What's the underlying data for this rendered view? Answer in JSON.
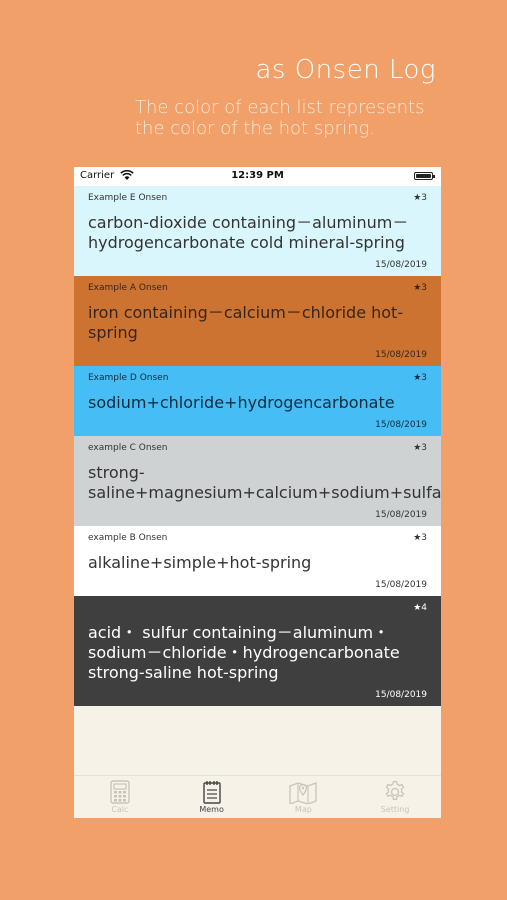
{
  "promo": {
    "headline": "as Onsen Log",
    "subline": "The color of each list represents the color of the hot spring."
  },
  "status_bar": {
    "carrier": "Carrier",
    "time": "12:39 PM"
  },
  "memos": [
    {
      "onsen": "Example E Onsen",
      "rating": "★3",
      "quality": "carbon-dioxide containing－aluminum－hydrogencarbonate cold mineral-spring",
      "date": "15/08/2019",
      "bg": "#d8f6fb",
      "fg": "#333333"
    },
    {
      "onsen": "Example A Onsen",
      "rating": "★3",
      "quality": "iron containing－calcium－chloride hot-spring",
      "date": "15/08/2019",
      "bg": "#cd7332",
      "fg": "#3a2415"
    },
    {
      "onsen": "Example D Onsen",
      "rating": "★3",
      "quality": "sodium+chloride+hydrogencarbonate",
      "date": "15/08/2019",
      "bg": "#46bdf5",
      "fg": "#0f2d3d"
    },
    {
      "onsen": "example C Onsen",
      "rating": "★3",
      "quality": "strong-saline+magnesium+calcium+sodium+sulfate",
      "date": "15/08/2019",
      "bg": "#cfd2d3",
      "fg": "#333333"
    },
    {
      "onsen": "example B Onsen",
      "rating": "★3",
      "quality": "alkaline+simple+hot-spring",
      "date": "15/08/2019",
      "bg": "#ffffff",
      "fg": "#333333"
    },
    {
      "onsen": "",
      "rating": "★4",
      "quality": "acid・ sulfur containing－aluminum・sodium－chloride・hydrogencarbonate strong-saline hot-spring",
      "date": "15/08/2019",
      "bg": "#3f3f3f",
      "fg": "#ffffff"
    }
  ],
  "tabs": [
    {
      "label": "Calc",
      "icon": "calculator-icon",
      "active": false
    },
    {
      "label": "Memo",
      "icon": "memo-icon",
      "active": true
    },
    {
      "label": "Map",
      "icon": "map-icon",
      "active": false
    },
    {
      "label": "Setting",
      "icon": "gear-icon",
      "active": false
    }
  ]
}
